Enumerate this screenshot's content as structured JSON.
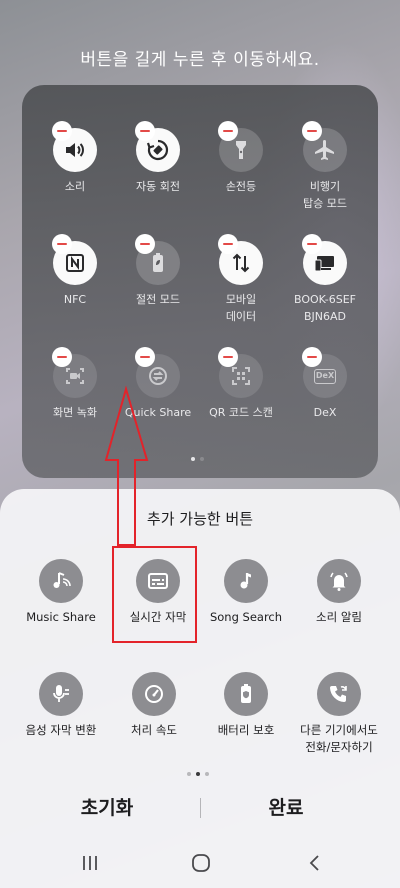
{
  "header": {
    "instruction": "버튼을 길게 누른 후 이동하세요."
  },
  "active_tiles": [
    {
      "label": "소리",
      "icon": "speaker-icon",
      "state": "active"
    },
    {
      "label": "자동 회전",
      "icon": "auto-rotate-icon",
      "state": "active"
    },
    {
      "label": "손전등",
      "icon": "flashlight-icon",
      "state": "inactive"
    },
    {
      "label": "비행기\n탑승 모드",
      "icon": "airplane-icon",
      "state": "inactive"
    },
    {
      "label": "NFC",
      "icon": "nfc-icon",
      "state": "active"
    },
    {
      "label": "절전 모드",
      "icon": "battery-saver-icon",
      "state": "inactive"
    },
    {
      "label": "모바일\n데이터",
      "icon": "mobile-data-icon",
      "state": "active"
    },
    {
      "label": "BOOK-6SEF\nBJN6AD",
      "icon": "device-connect-icon",
      "state": "active"
    },
    {
      "label": "화면 녹화",
      "icon": "screen-record-icon",
      "state": "dim"
    },
    {
      "label": "Quick Share",
      "icon": "quick-share-icon",
      "state": "dim"
    },
    {
      "label": "QR 코드 스캔",
      "icon": "qr-scan-icon",
      "state": "dim"
    },
    {
      "label": "DeX",
      "icon": "dex-icon",
      "state": "dim",
      "icon_text": "DeX"
    }
  ],
  "available": {
    "title": "추가 가능한 버튼",
    "buttons": [
      {
        "label": "Music Share",
        "icon": "music-share-icon"
      },
      {
        "label": "실시간 자막",
        "icon": "live-caption-icon"
      },
      {
        "label": "Song Search",
        "icon": "music-note-icon"
      },
      {
        "label": "소리 알림",
        "icon": "sound-notification-icon"
      },
      {
        "label": "음성 자막 변환",
        "icon": "voice-to-text-icon"
      },
      {
        "label": "처리 속도",
        "icon": "speedometer-icon"
      },
      {
        "label": "배터리 보호",
        "icon": "battery-protect-icon"
      },
      {
        "label": "다른 기기에서도\n전화/문자하기",
        "icon": "call-sync-icon"
      }
    ]
  },
  "actions": {
    "reset": "초기화",
    "done": "완료"
  },
  "colors": {
    "annotation_red": "#e3232a",
    "minus_red": "#e34a48"
  }
}
